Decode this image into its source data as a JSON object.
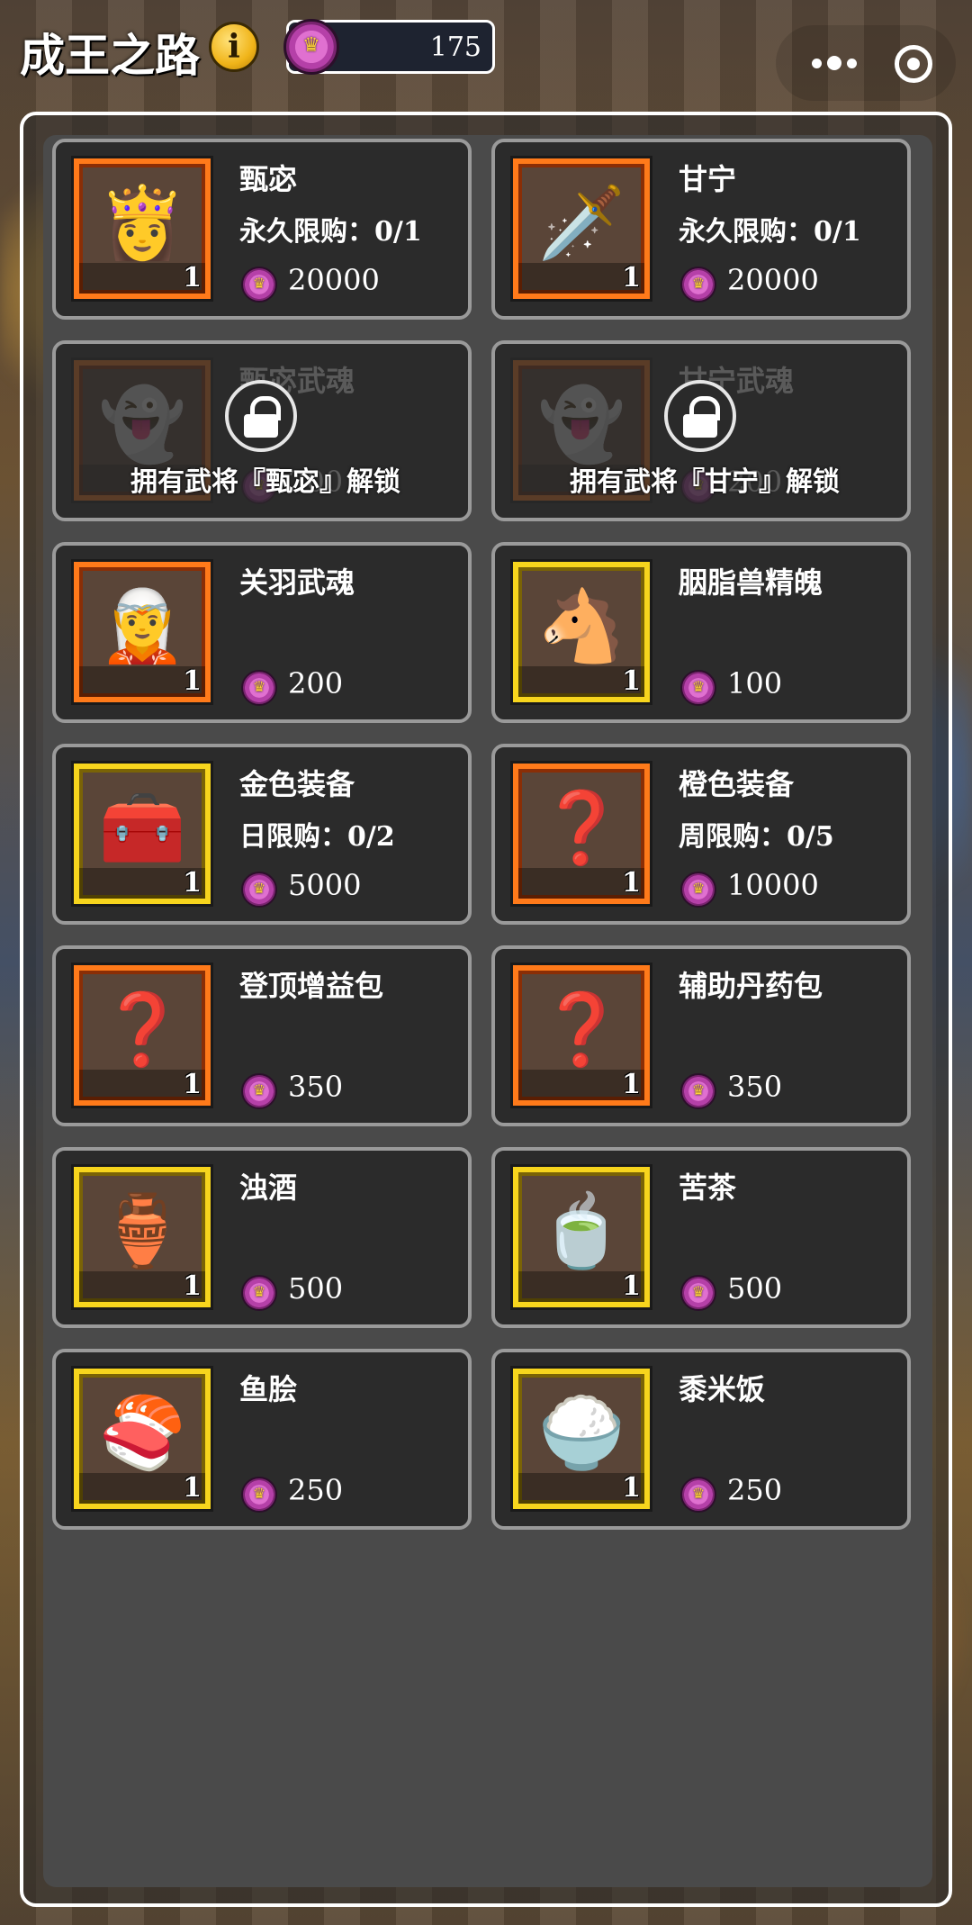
{
  "header": {
    "title": "成王之路",
    "info_icon": "info-icon",
    "info_glyph": "i",
    "currency": {
      "icon": "crown-coin-icon",
      "amount": "175"
    },
    "capsule": {
      "more_icon": "more-dots-icon",
      "close_icon": "target-icon"
    }
  },
  "colors": {
    "rarity_orange": "#ff7a1a",
    "rarity_gold": "#f7d51d",
    "card_border": "#9a9a9a",
    "card_bg": "#2b2b2b"
  },
  "shop": {
    "items": [
      {
        "name": "甄宓",
        "limit": "永久限购：0/1",
        "price": "20000",
        "count": "1",
        "rarity": "orange",
        "icon": "general-zhenmi-icon",
        "glyph": "👸",
        "locked": false
      },
      {
        "name": "甘宁",
        "limit": "永久限购：0/1",
        "price": "20000",
        "count": "1",
        "rarity": "orange",
        "icon": "general-ganning-icon",
        "glyph": "🗡️",
        "locked": false
      },
      {
        "name": "甄宓武魂",
        "limit": "",
        "price": "200",
        "count": "1",
        "rarity": "orange",
        "icon": "zhenmi-soul-icon",
        "glyph": "👻",
        "locked": true,
        "lock_text": "拥有武将『甄宓』解锁"
      },
      {
        "name": "甘宁武魂",
        "limit": "",
        "price": "200",
        "count": "1",
        "rarity": "orange",
        "icon": "ganning-soul-icon",
        "glyph": "👻",
        "locked": true,
        "lock_text": "拥有武将『甘宁』解锁"
      },
      {
        "name": "关羽武魂",
        "limit": "",
        "price": "200",
        "count": "1",
        "rarity": "orange",
        "icon": "guanyu-soul-icon",
        "glyph": "🧝",
        "locked": false
      },
      {
        "name": "胭脂兽精魄",
        "limit": "",
        "price": "100",
        "count": "1",
        "rarity": "gold",
        "icon": "horse-spirit-icon",
        "glyph": "🐴",
        "locked": false
      },
      {
        "name": "金色装备",
        "limit": "日限购：0/2",
        "price": "5000",
        "count": "1",
        "rarity": "gold",
        "icon": "gold-chest-icon",
        "glyph": "🧰",
        "locked": false
      },
      {
        "name": "橙色装备",
        "limit": "周限购：0/5",
        "price": "10000",
        "count": "1",
        "rarity": "orange",
        "icon": "mystery-chest-icon",
        "glyph": "❓",
        "locked": false
      },
      {
        "name": "登顶增益包",
        "limit": "",
        "price": "350",
        "count": "1",
        "rarity": "orange",
        "icon": "buff-pack-icon",
        "glyph": "❓",
        "locked": false
      },
      {
        "name": "辅助丹药包",
        "limit": "",
        "price": "350",
        "count": "1",
        "rarity": "orange",
        "icon": "pill-pack-icon",
        "glyph": "❓",
        "locked": false
      },
      {
        "name": "浊酒",
        "limit": "",
        "price": "500",
        "count": "1",
        "rarity": "gold",
        "icon": "wine-jar-icon",
        "glyph": "🏺",
        "locked": false
      },
      {
        "name": "苦茶",
        "limit": "",
        "price": "500",
        "count": "1",
        "rarity": "gold",
        "icon": "tea-bowl-icon",
        "glyph": "🍵",
        "locked": false
      },
      {
        "name": "鱼脍",
        "limit": "",
        "price": "250",
        "count": "1",
        "rarity": "gold",
        "icon": "fish-dish-icon",
        "glyph": "🍣",
        "locked": false
      },
      {
        "name": "黍米饭",
        "limit": "",
        "price": "250",
        "count": "1",
        "rarity": "gold",
        "icon": "rice-bowl-icon",
        "glyph": "🍚",
        "locked": false
      }
    ]
  }
}
